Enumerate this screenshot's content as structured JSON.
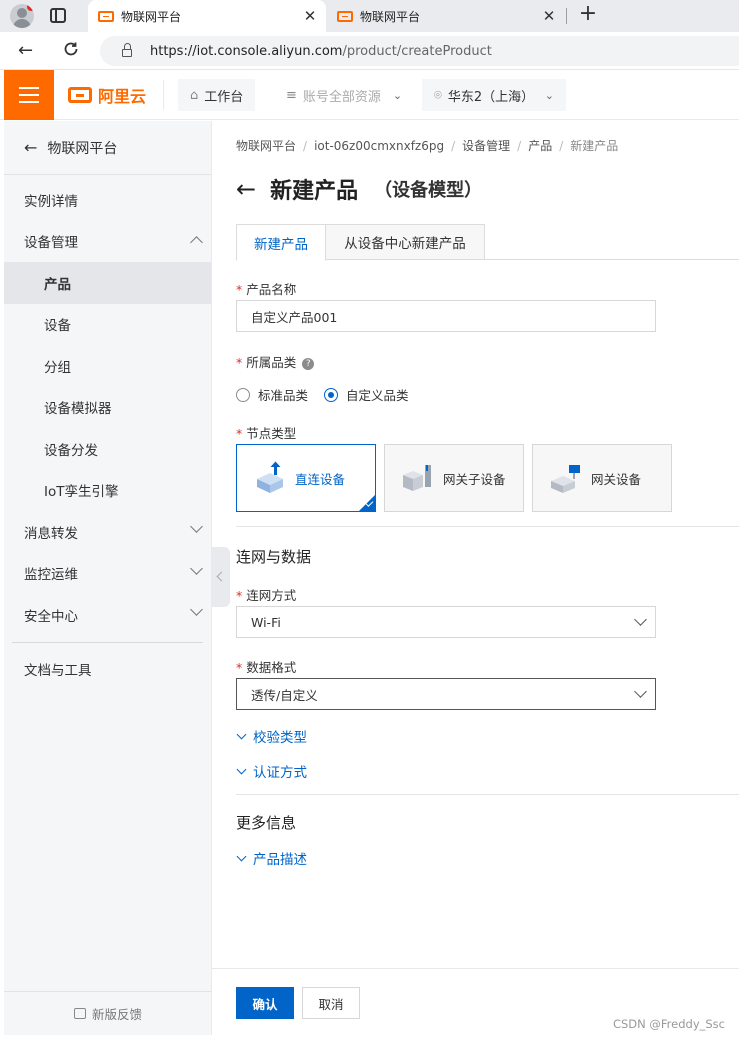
{
  "browser": {
    "tabs": [
      {
        "label": "物联网平台",
        "active": true
      },
      {
        "label": "物联网平台",
        "active": false
      }
    ],
    "close_glyph": "✕",
    "new_tab_glyph": "+",
    "url_host": "https://iot.console.aliyun.com",
    "url_path": "/product/createProduct"
  },
  "topbar": {
    "brand": "阿里云",
    "workbench": "工作台",
    "resources": "账号全部资源",
    "region": "华东2（上海）"
  },
  "sidebar": {
    "back_label": "物联网平台",
    "items": [
      {
        "label": "实例详情"
      },
      {
        "label": "设备管理"
      },
      {
        "label": "产品"
      },
      {
        "label": "设备"
      },
      {
        "label": "分组"
      },
      {
        "label": "设备模拟器"
      },
      {
        "label": "设备分发"
      },
      {
        "label": "IoT孪生引擎"
      },
      {
        "label": "消息转发"
      },
      {
        "label": "监控运维"
      },
      {
        "label": "安全中心"
      },
      {
        "label": "文档与工具"
      }
    ],
    "feedback": "新版反馈"
  },
  "main": {
    "breadcrumb": [
      "物联网平台",
      "iot-06z00cmxnxfz6pg",
      "设备管理",
      "产品",
      "新建产品"
    ],
    "title": "新建产品",
    "subtitle": "（设备模型）",
    "tabs": [
      "新建产品",
      "从设备中心新建产品"
    ],
    "product_name": {
      "label": "产品名称",
      "value": "自定义产品001"
    },
    "category": {
      "label": "所属品类",
      "options": [
        "标准品类",
        "自定义品类"
      ],
      "selected": "自定义品类"
    },
    "node_type": {
      "label": "节点类型",
      "options": [
        "直连设备",
        "网关子设备",
        "网关设备"
      ],
      "selected": "直连设备"
    },
    "network_section": "连网与数据",
    "network_method": {
      "label": "连网方式",
      "value": "Wi-Fi"
    },
    "data_format": {
      "label": "数据格式",
      "value": "透传/自定义"
    },
    "check_type": "校验类型",
    "auth_method": "认证方式",
    "more_section": "更多信息",
    "product_desc": "产品描述"
  },
  "footer": {
    "confirm": "确认",
    "cancel": "取消",
    "watermark": "CSDN @Freddy_Ssc"
  },
  "colors": {
    "brand_orange": "#ff6a00",
    "primary_blue": "#0064c8",
    "required_red": "#d93026"
  }
}
